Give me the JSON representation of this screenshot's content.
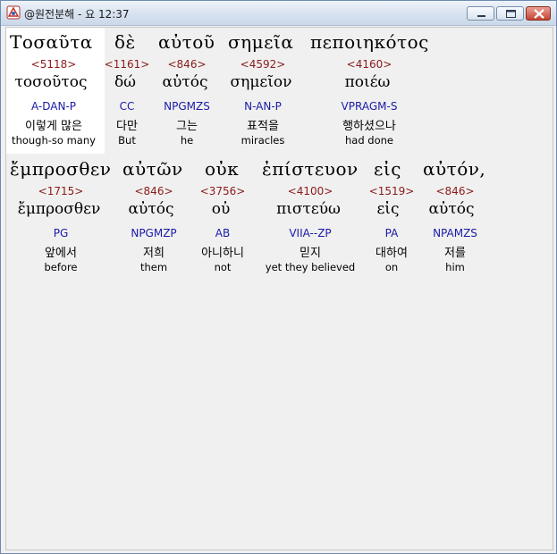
{
  "window": {
    "title": "@원전분해 - 요 12:37",
    "icon": "bible-app-icon",
    "buttons": [
      "minimize",
      "maximize",
      "close"
    ]
  },
  "rows": [
    {
      "words": [
        {
          "greek": "Τοσαῦτα",
          "strong": "<5118>",
          "lemma": "τοσοῦτος",
          "parse": "A-DAN-P",
          "korean": "이렇게 많은",
          "english": "though-so many"
        },
        {
          "greek": "δὲ",
          "strong": "<1161>",
          "lemma": "δώ",
          "parse": "CC",
          "korean": "다만",
          "english": "But"
        },
        {
          "greek": "αὐτοῦ",
          "strong": "<846>",
          "lemma": "αὐτός",
          "parse": "NPGMZS",
          "korean": "그는",
          "english": "he"
        },
        {
          "greek": "σημεῖα",
          "strong": "<4592>",
          "lemma": "σημεῖον",
          "parse": "N-AN-P",
          "korean": "표적을",
          "english": "miracles"
        },
        {
          "greek": "πεποιηκότος",
          "strong": "<4160>",
          "lemma": "ποιέω",
          "parse": "VPRAGM-S",
          "korean": "행하셨으나",
          "english": "had done"
        }
      ]
    },
    {
      "words": [
        {
          "greek": "ἔμπροσθεν",
          "strong": "<1715>",
          "lemma": "ἔμπροσθεν",
          "parse": "PG",
          "korean": "앞에서",
          "english": "before"
        },
        {
          "greek": "αὐτῶν",
          "strong": "<846>",
          "lemma": "αὐτός",
          "parse": "NPGMZP",
          "korean": "저희",
          "english": "them"
        },
        {
          "greek": "οὐκ",
          "strong": "<3756>",
          "lemma": "οὐ",
          "parse": "AB",
          "korean": "아니하니",
          "english": "not"
        },
        {
          "greek": "ἐπίστευον",
          "strong": "<4100>",
          "lemma": "πιστεύω",
          "parse": "VIIA--ZP",
          "korean": "믿지",
          "english": "yet they believed"
        },
        {
          "greek": "εἰς",
          "strong": "<1519>",
          "lemma": "εἰς",
          "parse": "PA",
          "korean": "대하여",
          "english": "on"
        },
        {
          "greek": "αὐτόν,",
          "strong": "<846>",
          "lemma": "αὐτός",
          "parse": "NPAMZS",
          "korean": "저를",
          "english": "him"
        }
      ]
    }
  ]
}
